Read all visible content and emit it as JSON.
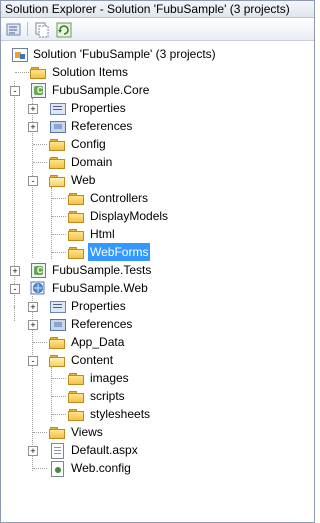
{
  "window": {
    "title": "Solution Explorer - Solution 'FubuSample' (3 projects)"
  },
  "toolbar": {
    "buttons": [
      {
        "name": "properties-button",
        "icon": "properties-icon"
      },
      {
        "name": "show-all-files-button",
        "icon": "show-all-files-icon"
      },
      {
        "name": "refresh-button",
        "icon": "refresh-icon"
      }
    ]
  },
  "tree": {
    "items": [
      {
        "label": "Solution 'FubuSample' (3 projects)",
        "icon": "solution-icon"
      },
      {
        "label": "Solution Items",
        "icon": "folder-icon"
      },
      {
        "label": "FubuSample.Core",
        "icon": "csharp-project-icon",
        "expander": "-"
      },
      {
        "label": "Properties",
        "icon": "properties-icon",
        "expander": "+"
      },
      {
        "label": "References",
        "icon": "references-icon",
        "expander": "+"
      },
      {
        "label": "Config",
        "icon": "folder-icon"
      },
      {
        "label": "Domain",
        "icon": "folder-icon"
      },
      {
        "label": "Web",
        "icon": "folder-open-icon",
        "expander": "-"
      },
      {
        "label": "Controllers",
        "icon": "folder-icon"
      },
      {
        "label": "DisplayModels",
        "icon": "folder-icon"
      },
      {
        "label": "Html",
        "icon": "folder-icon"
      },
      {
        "label": "WebForms",
        "icon": "folder-icon",
        "selected": true
      },
      {
        "label": "FubuSample.Tests",
        "icon": "csharp-project-icon",
        "expander": "+"
      },
      {
        "label": "FubuSample.Web",
        "icon": "web-project-icon",
        "expander": "-"
      },
      {
        "label": "Properties",
        "icon": "properties-icon",
        "expander": "+"
      },
      {
        "label": "References",
        "icon": "references-icon",
        "expander": "+"
      },
      {
        "label": "App_Data",
        "icon": "folder-icon"
      },
      {
        "label": "Content",
        "icon": "folder-open-icon",
        "expander": "-"
      },
      {
        "label": "images",
        "icon": "folder-icon"
      },
      {
        "label": "scripts",
        "icon": "folder-icon"
      },
      {
        "label": "stylesheets",
        "icon": "folder-icon"
      },
      {
        "label": "Views",
        "icon": "folder-icon"
      },
      {
        "label": "Default.aspx",
        "icon": "aspx-file-icon",
        "expander": "+"
      },
      {
        "label": "Web.config",
        "icon": "config-file-icon"
      }
    ]
  }
}
